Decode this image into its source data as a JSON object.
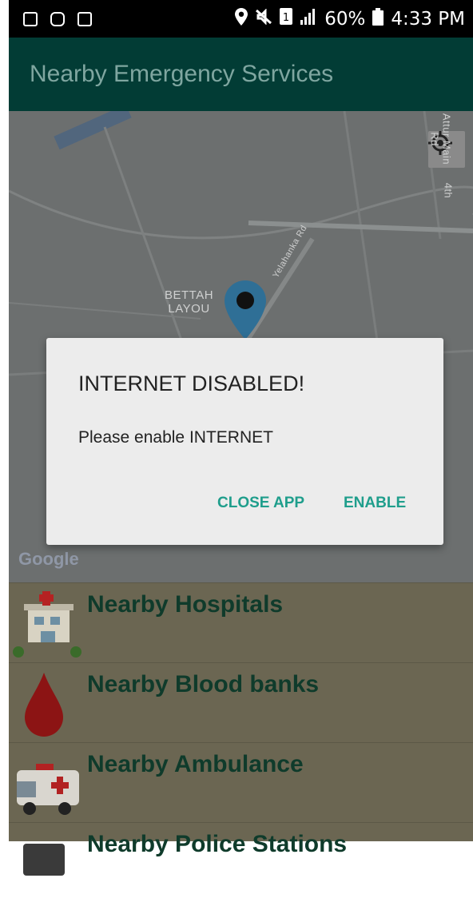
{
  "status_bar": {
    "battery": "60%",
    "time": "4:33 PM",
    "left_icons": [
      "gallery-icon",
      "instagram-icon",
      "cast-icon"
    ],
    "right_icons": [
      "location-icon",
      "mute-icon",
      "sim-icon",
      "signal-icon",
      "battery-icon"
    ]
  },
  "app_bar": {
    "title": "Nearby Emergency Services"
  },
  "map": {
    "labels": {
      "bettah_line1": "BETTAH",
      "bettah_line2": "LAYOU",
      "road": "Yelahanka Rd",
      "main_rd": "Attur Main Rd",
      "fourth": "4th"
    },
    "google": "Google",
    "locate_icon": "my-location-icon"
  },
  "dialog": {
    "title": "INTERNET DISABLED!",
    "message": "Please enable INTERNET",
    "close_label": "CLOSE APP",
    "enable_label": "ENABLE"
  },
  "list": [
    {
      "label": "Nearby Hospitals",
      "icon": "hospital-icon"
    },
    {
      "label": "Nearby Blood banks",
      "icon": "blood-drop-icon"
    },
    {
      "label": "Nearby Ambulance",
      "icon": "ambulance-icon"
    },
    {
      "label": "Nearby Police Stations",
      "icon": "police-icon"
    }
  ],
  "colors": {
    "app_bar": "#023c35",
    "accent": "#1f9e8c",
    "list_text": "#0f3b2b"
  }
}
